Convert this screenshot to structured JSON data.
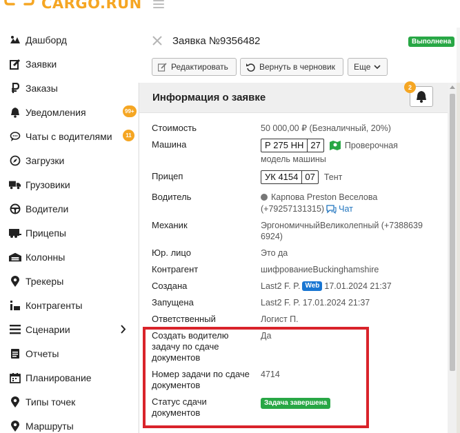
{
  "brand": {
    "name": "CARGO.RUN",
    "accent": "#f5a623"
  },
  "sidebar": {
    "items": [
      {
        "label": "Дашборд",
        "icon": "dashboard-icon"
      },
      {
        "label": "Заявки",
        "icon": "edit-icon"
      },
      {
        "label": "Заказы",
        "icon": "ruble-icon"
      },
      {
        "label": "Уведомления",
        "icon": "bell-icon",
        "badge": "99+"
      },
      {
        "label": "Чаты с водителями",
        "icon": "chat-icon",
        "badge": "11"
      },
      {
        "label": "Загрузки",
        "icon": "compass-icon"
      },
      {
        "label": "Грузовики",
        "icon": "truck-icon"
      },
      {
        "label": "Водители",
        "icon": "steering-wheel-icon"
      },
      {
        "label": "Прицепы",
        "icon": "trailer-icon"
      },
      {
        "label": "Колонны",
        "icon": "warehouse-icon"
      },
      {
        "label": "Трекеры",
        "icon": "map-pin-icon"
      },
      {
        "label": "Контрагенты",
        "icon": "contractors-icon"
      },
      {
        "label": "Сценарии",
        "icon": "list-icon",
        "has_children": true
      },
      {
        "label": "Отчеты",
        "icon": "report-icon"
      },
      {
        "label": "Планирование",
        "icon": "calendar-icon"
      },
      {
        "label": "Типы точек",
        "icon": "map-pin-icon"
      },
      {
        "label": "Маршруты",
        "icon": "route-icon"
      }
    ]
  },
  "order": {
    "title": "Заявка №9356482",
    "status": "Выполнена",
    "buttons": {
      "edit": "Редактировать",
      "revert": "Вернуть в черновик",
      "more": "Еще"
    }
  },
  "info": {
    "title": "Информация о заявке",
    "notification_count": "2",
    "fields": {
      "cost": {
        "label": "Стоимость",
        "value": "50 000,00 ₽ (Безналичный, 20%)"
      },
      "vehicle": {
        "label": "Машина",
        "plate": "Р 275 НН",
        "region": "27",
        "status_text": "Проверочная",
        "model": "модель машины"
      },
      "trailer": {
        "label": "Прицеп",
        "plate": "УК 4154",
        "region": "07",
        "type": "Тент"
      },
      "driver": {
        "label": "Водитель",
        "name": "Карпова Preston Веселова",
        "phone": "(+79257131315)",
        "chat": "Чат"
      },
      "mechanic": {
        "label": "Механик",
        "line1": "ЭргономичныйВеликолепный (+7388639",
        "line2": "6924)"
      },
      "legal": {
        "label": "Юр. лицо",
        "value": "Это да"
      },
      "counterparty": {
        "label": "Контрагент",
        "value": "шифрованиеBuckinghamshire"
      },
      "created": {
        "label": "Создана",
        "user": "Last2 F. P.",
        "source": "Web",
        "datetime": "17.01.2024 21:37"
      },
      "launched": {
        "label": "Запущена",
        "value": "Last2 F. P. 17.01.2024 21:37"
      },
      "responsible": {
        "label": "Ответственный",
        "value": "Логист П."
      },
      "create_task": {
        "label_line1": "Создать водителю",
        "label_line2": "задачу по сдаче",
        "label_line3": "документов",
        "value": "Да"
      },
      "task_number": {
        "label_line1": "Номер задачи по сдаче",
        "label_line2": "документов",
        "value": "4714"
      },
      "doc_status": {
        "label_line1": "Статус сдачи",
        "label_line2": "документов",
        "value": "Задача завершена"
      }
    }
  }
}
